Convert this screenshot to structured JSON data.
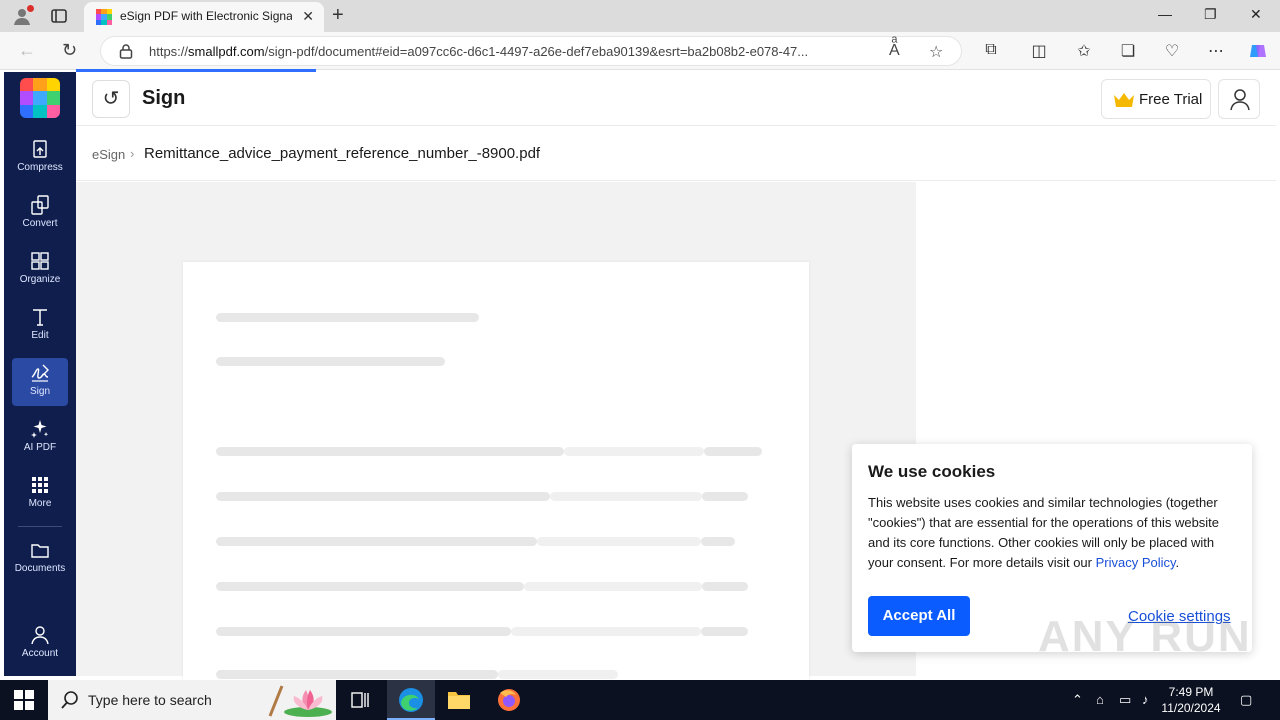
{
  "browser": {
    "tab_title": "eSign PDF with Electronic Signat",
    "url_prefix": "https://",
    "url_host": "smallpdf.com",
    "url_rest": "/sign-pdf/document#eid=a097cc6c-d6c1-4497-a26e-def7eba90139&esrt=ba2b08b2-e078-47..."
  },
  "sidebar": {
    "items": [
      {
        "label": "Compress",
        "icon": "compress-icon"
      },
      {
        "label": "Convert",
        "icon": "convert-icon"
      },
      {
        "label": "Organize",
        "icon": "organize-icon"
      },
      {
        "label": "Edit",
        "icon": "edit-icon"
      },
      {
        "label": "Sign",
        "icon": "sign-icon"
      },
      {
        "label": "AI PDF",
        "icon": "sparkle-icon"
      },
      {
        "label": "More",
        "icon": "grid-icon"
      },
      {
        "label": "Documents",
        "icon": "folder-icon"
      },
      {
        "label": "Account",
        "icon": "user-icon"
      }
    ],
    "active": "Sign",
    "bg_color": "#0f1e4d"
  },
  "header": {
    "title": "Sign",
    "free_trial_label": "Free Trial"
  },
  "breadcrumb": {
    "root": "eSign",
    "separator": "›",
    "file": "Remittance_advice_payment_reference_number_-8900.pdf"
  },
  "cookie_banner": {
    "title": "We use cookies",
    "text": "This website uses cookies and similar technologies (together \"cookies\") that are essential for the operations of this website and its core functions. Other cookies will only be placed with your consent. For more details visit our ",
    "link": "Privacy Policy",
    "text_end": ".",
    "accept_label": "Accept All",
    "settings_label": "Cookie settings",
    "accent_color": "#0a5cff"
  },
  "watermark": "ANY RUN",
  "taskbar": {
    "search_placeholder": "Type here to search",
    "time": "7:49 PM",
    "date": "11/20/2024"
  }
}
